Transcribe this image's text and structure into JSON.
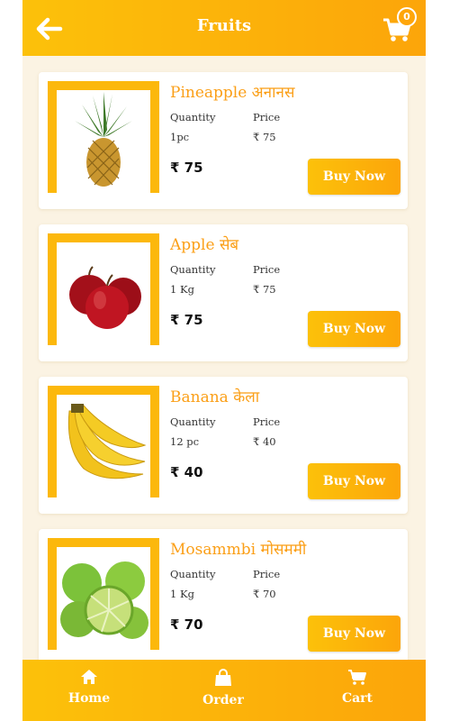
{
  "header": {
    "title": "Fruits",
    "cart_count": "0"
  },
  "products": [
    {
      "name": "Pineapple अनानस",
      "quantity_label": "Quantity",
      "price_label": "Price",
      "quantity": "1pc",
      "price": "₹ 75",
      "price_big": "₹ 75",
      "buy_label": "Buy Now",
      "image": "pineapple"
    },
    {
      "name": "Apple सेब",
      "quantity_label": "Quantity",
      "price_label": "Price",
      "quantity": "1 Kg",
      "price": "₹ 75",
      "price_big": "₹ 75",
      "buy_label": "Buy Now",
      "image": "apples"
    },
    {
      "name": "Banana केला",
      "quantity_label": "Quantity",
      "price_label": "Price",
      "quantity": "12 pc",
      "price": "₹ 40",
      "price_big": "₹ 40",
      "buy_label": "Buy Now",
      "image": "bananas"
    },
    {
      "name": "Mosammbi मोसममी",
      "quantity_label": "Quantity",
      "price_label": "Price",
      "quantity": "1 Kg",
      "price": "₹ 70",
      "price_big": "₹ 70",
      "buy_label": "Buy Now",
      "image": "sweet-limes"
    }
  ],
  "footer": {
    "items": [
      {
        "label": "Home",
        "icon": "home-icon"
      },
      {
        "label": "Order",
        "icon": "bag-icon"
      },
      {
        "label": "Cart",
        "icon": "cart-icon"
      }
    ]
  },
  "colors": {
    "accent": "#fcb80c",
    "accent_dark": "#fca50a",
    "title_orange": "#fb9f17",
    "background": "#fbf3e3"
  }
}
